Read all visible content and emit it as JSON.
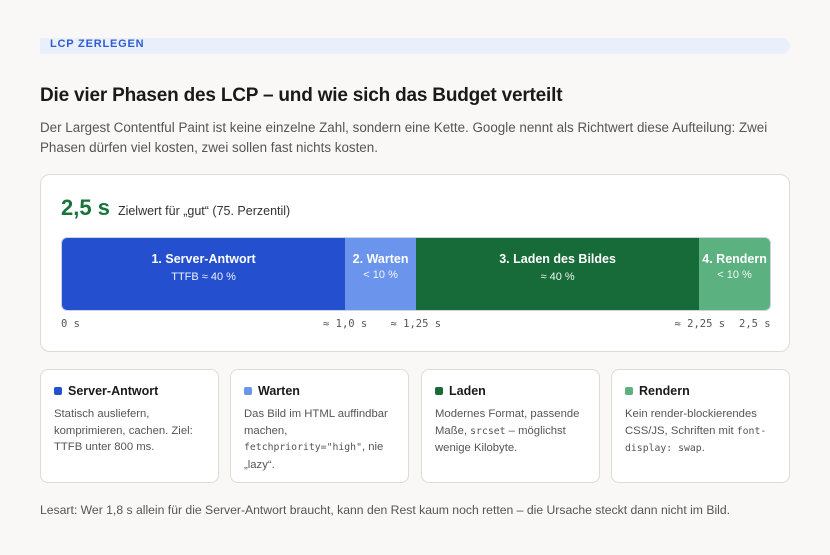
{
  "kicker": "LCP zerlegen",
  "title": "Die vier Phasen des LCP – und wie sich das Budget verteilt",
  "lead": "Der Largest Contentful Paint ist keine einzelne Zahl, sondern eine Kette. Google nennt als Richtwert diese Aufteilung: Zwei Phasen dürfen viel kosten, zwei sollen fast nichts kosten.",
  "target": {
    "value": "2,5 s",
    "label": "Zielwert für „gut“ (75. Perzentil)"
  },
  "colors": {
    "server": "#2450cf",
    "warten": "#6b95ec",
    "laden": "#176b38",
    "rendern": "#5bb17f"
  },
  "chart_data": {
    "type": "bar",
    "orientation": "horizontal-stacked",
    "total_seconds": 2.5,
    "segments": [
      {
        "title": "1. Server-Antwort",
        "sub": "TTFB ≈ 40 %",
        "share": 40,
        "color": "#2450cf"
      },
      {
        "title": "2. Warten",
        "sub": "< 10 %",
        "share": 10,
        "color": "#6b95ec"
      },
      {
        "title": "3. Laden des Bildes",
        "sub": "≈ 40 %",
        "share": 40,
        "color": "#176b38"
      },
      {
        "title": "4. Rendern",
        "sub": "< 10 %",
        "share": 10,
        "color": "#5bb17f"
      }
    ],
    "ticks": [
      {
        "label": "0 s",
        "value": 0
      },
      {
        "label": "≈ 1,0 s",
        "value": 1.0
      },
      {
        "label": "≈ 1,25 s",
        "value": 1.25
      },
      {
        "label": "≈ 2,25 s",
        "value": 2.25
      },
      {
        "label": "2,5 s",
        "value": 2.5
      }
    ]
  },
  "phases": [
    {
      "name": "Server-Antwort",
      "color": "#2450cf",
      "parts": [
        {
          "t": "Statisch ausliefern, komprimieren, cachen. Ziel: TTFB unter 800 ms."
        }
      ]
    },
    {
      "name": "Warten",
      "color": "#6b95ec",
      "parts": [
        {
          "t": "Das Bild im HTML auffindbar machen, "
        },
        {
          "t": "fetchpriority=\"high\"",
          "code": true
        },
        {
          "t": ", nie „lazy“."
        }
      ]
    },
    {
      "name": "Laden",
      "color": "#176b38",
      "parts": [
        {
          "t": "Modernes Format, passende Maße, "
        },
        {
          "t": "srcset",
          "code": true
        },
        {
          "t": " – möglichst wenige Kilobyte."
        }
      ]
    },
    {
      "name": "Rendern",
      "color": "#5bb17f",
      "parts": [
        {
          "t": "Kein render-blockierendes CSS/JS, Schriften mit "
        },
        {
          "t": "font-display: swap",
          "code": true
        },
        {
          "t": "."
        }
      ]
    }
  ],
  "note": "Lesart: Wer 1,8 s allein für die Server-Antwort braucht, kann den Rest kaum noch retten – die Ursache steckt dann nicht im Bild."
}
